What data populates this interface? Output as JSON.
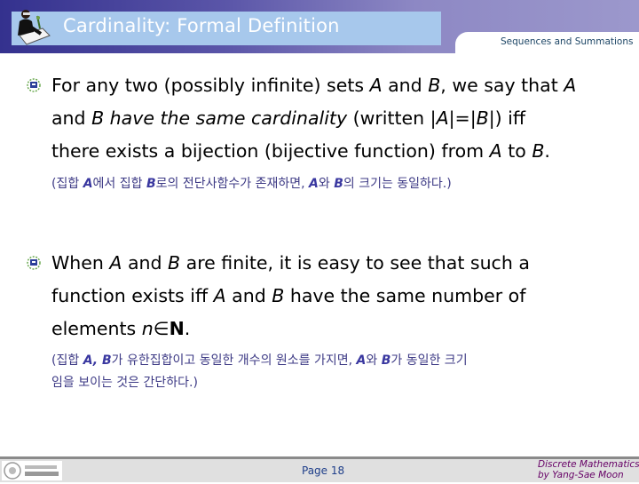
{
  "header": {
    "title": "Cardinality: Formal Definition",
    "subtitle": "Sequences and Summations",
    "logo_icon": "person-writing-icon"
  },
  "bullets": [
    {
      "icon": "bullet-badge-icon",
      "lines": [
        [
          "For any two (possibly infinite) sets ",
          {
            "i": "A"
          },
          " and ",
          {
            "i": "B"
          },
          ", we say that ",
          {
            "i": "A"
          }
        ],
        [
          "and ",
          {
            "i": "B have the same cardinality"
          },
          " (written |",
          {
            "i": "A"
          },
          "|=|",
          {
            "i": "B"
          },
          "|) iff"
        ],
        [
          "there exists a bijection (bijective function) from ",
          {
            "i": "A"
          },
          " to ",
          {
            "i": "B"
          },
          "."
        ]
      ],
      "korean": [
        [
          "(집합 ",
          {
            "b": "A"
          },
          "에서 집합 ",
          {
            "b": "B"
          },
          "로의 전단사함수가 존재하면, ",
          {
            "b": "A"
          },
          "와 ",
          {
            "b": "B"
          },
          "의 크기는 동일하다.)"
        ]
      ]
    },
    {
      "icon": "bullet-badge-icon",
      "lines": [
        [
          "When ",
          {
            "i": "A"
          },
          " and ",
          {
            "i": "B"
          },
          " are finite, it is easy to see that such a"
        ],
        [
          "function exists iff ",
          {
            "i": "A"
          },
          " and ",
          {
            "i": "B"
          },
          " have the same number of"
        ],
        [
          "elements ",
          {
            "i": "n"
          },
          "∈",
          {
            "bold": "N"
          },
          "."
        ]
      ],
      "korean": [
        [
          "(집합 ",
          {
            "b": "A, B"
          },
          "가 유한집합이고 동일한 개수의 원소를 가지면, ",
          {
            "b": "A"
          },
          "와 ",
          {
            "b": "B"
          },
          "가 동일한 크기"
        ],
        [
          "임을 보이는 것은 간단하다.)"
        ]
      ]
    }
  ],
  "footer": {
    "page": "Page 18",
    "credit_line1": "Discrete Mathematics",
    "credit_line2": "by Yang-Sae Moon",
    "logo": "university-logo"
  }
}
